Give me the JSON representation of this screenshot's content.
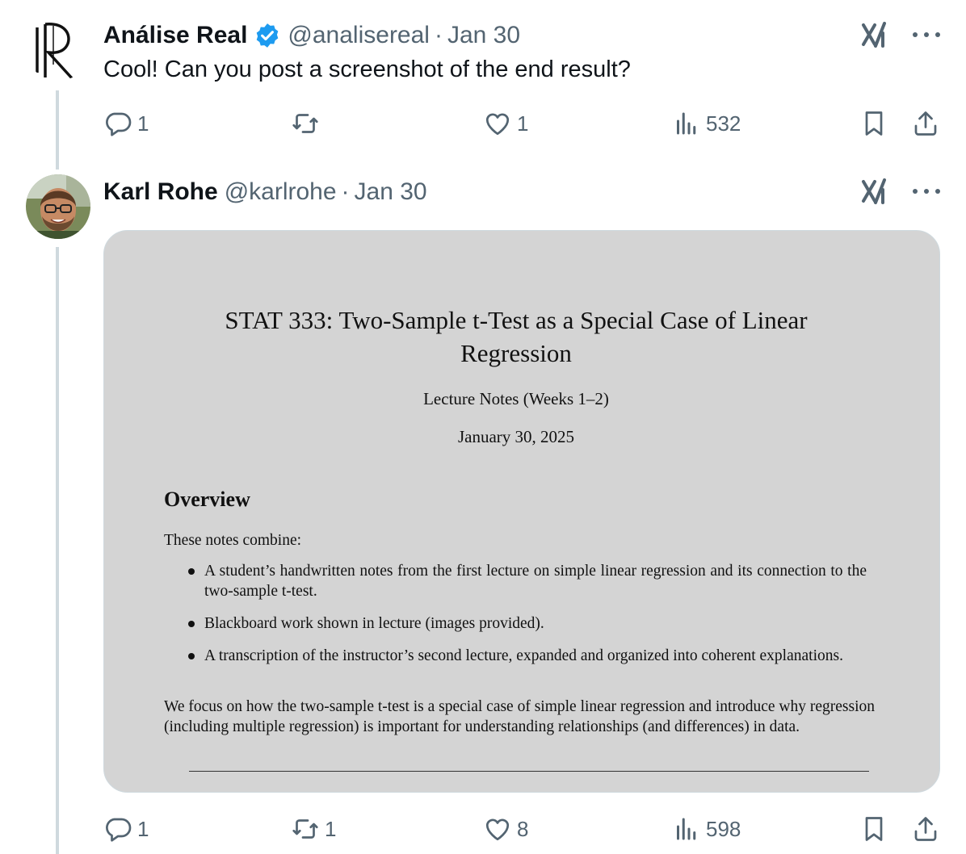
{
  "tweets": [
    {
      "display_name": "Análise Real",
      "verified": true,
      "handle": "@analisereal",
      "separator": "·",
      "date": "Jan 30",
      "text": "Cool! Can you post a screenshot of the end result?",
      "avatar": "logo-ir-monogram",
      "actions": {
        "reply_count": "1",
        "repost_count": "",
        "like_count": "1",
        "view_count": "532"
      }
    },
    {
      "display_name": "Karl Rohe",
      "verified": false,
      "handle": "@karlrohe",
      "separator": "·",
      "date": "Jan 30",
      "avatar": "profile-photo-smiling-man-glasses",
      "actions": {
        "reply_count": "1",
        "repost_count": "1",
        "like_count": "8",
        "view_count": "598"
      },
      "media": {
        "title": "STAT 333: Two-Sample t-Test as a Special Case of Linear Regression",
        "subtitle": "Lecture Notes (Weeks 1–2)",
        "date": "January 30, 2025",
        "section_heading": "Overview",
        "intro": "These notes combine:",
        "bullets": [
          "A student’s handwritten notes from the first lecture on simple linear regression and its connection to the two-sample t-test.",
          "Blackboard work shown in lecture (images provided).",
          "A transcription of the instructor’s second lecture, expanded and organized into coherent explanations."
        ],
        "outro": "We focus on how the two-sample t-test is a special case of simple linear regression and introduce why regression (including multiple regression) is important for understanding relationships (and differences) in data."
      }
    }
  ],
  "icons": {
    "verified": "verified-badge-icon",
    "grok": "grok-icon",
    "more": "more-icon",
    "reply": "reply-icon",
    "repost": "repost-icon",
    "like": "heart-icon",
    "views": "views-icon",
    "bookmark": "bookmark-icon",
    "share": "share-icon"
  },
  "colors": {
    "text_primary": "#0f1419",
    "text_secondary": "#536471",
    "verified_blue": "#1d9bf0",
    "thread_line": "#cfd9de",
    "media_background": "#d4d4d4"
  }
}
